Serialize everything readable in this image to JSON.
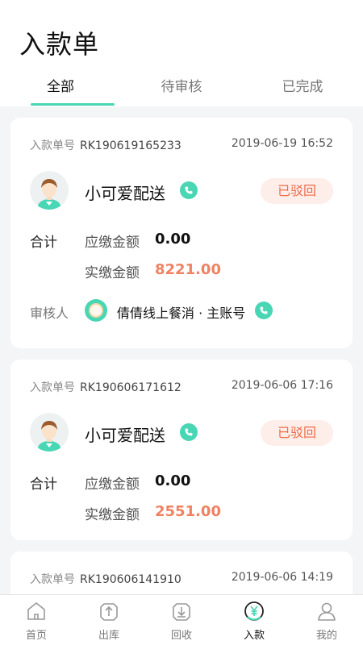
{
  "header": {
    "title": "入款单"
  },
  "tabs": [
    {
      "label": "全部",
      "active": true
    },
    {
      "label": "待审核",
      "active": false
    },
    {
      "label": "已完成",
      "active": false
    }
  ],
  "orders": [
    {
      "order_label": "入款单号",
      "order_no": "RK190619165233",
      "time": "2019-06-19 16:52",
      "customer": "小可爱配送",
      "status": "已驳回",
      "total_label": "合计",
      "due_label": "应缴金额",
      "due_value": "0.00",
      "paid_label": "实缴金额",
      "paid_value": "8221.00",
      "reviewer_label": "审核人",
      "reviewer_name": "倩倩线上餐消 · 主账号"
    },
    {
      "order_label": "入款单号",
      "order_no": "RK190606171612",
      "time": "2019-06-06 17:16",
      "customer": "小可爱配送",
      "status": "已驳回",
      "total_label": "合计",
      "due_label": "应缴金额",
      "due_value": "0.00",
      "paid_label": "实缴金额",
      "paid_value": "2551.00"
    },
    {
      "order_label": "入款单号",
      "order_no": "RK190606141910",
      "time": "2019-06-06 14:19"
    }
  ],
  "tabbar": [
    {
      "label": "首页",
      "icon": "home-icon"
    },
    {
      "label": "出库",
      "icon": "outbound-icon"
    },
    {
      "label": "回收",
      "icon": "recycle-icon"
    },
    {
      "label": "入款",
      "icon": "deposit-icon",
      "active": true
    },
    {
      "label": "我的",
      "icon": "profile-icon"
    }
  ],
  "colors": {
    "accent": "#49d6b4",
    "reject": "#ef6c4a",
    "paid": "#ef8263"
  }
}
